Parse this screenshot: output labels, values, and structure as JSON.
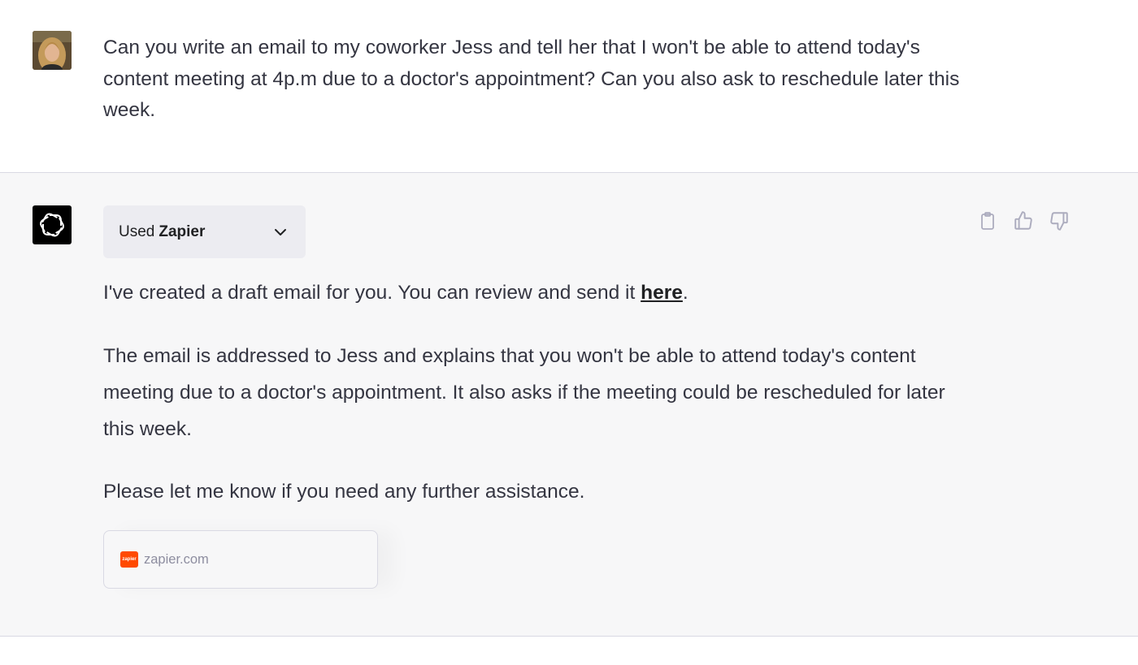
{
  "user_message": {
    "text": "Can you write an email to my coworker Jess and tell her that I won't be able to attend today's content meeting at 4p.m due to a doctor's appointment? Can you also ask to reschedule later this week."
  },
  "assistant_message": {
    "plugin_prefix": "Used",
    "plugin_name": "Zapier",
    "paragraph1_before_link": "I've created a draft email for you. You can review and send it ",
    "paragraph1_link": "here",
    "paragraph1_after_link": ".",
    "paragraph2": "The email is addressed to Jess and explains that you won't be able to attend today's content meeting due to a doctor's appointment. It also asks if the meeting could be rescheduled for later this week.",
    "paragraph3": "Please let me know if you need any further assistance.",
    "source_domain": "zapier.com",
    "source_favicon_text": "zapier"
  },
  "icons": {
    "copy": "clipboard-icon",
    "like": "thumbs-up-icon",
    "dislike": "thumbs-down-icon",
    "logo": "openai-logo-icon",
    "chevron": "chevron-down-icon"
  },
  "colors": {
    "assistant_bg": "#f7f7f8",
    "text": "#343541",
    "zapier_brand": "#ff4a00"
  }
}
